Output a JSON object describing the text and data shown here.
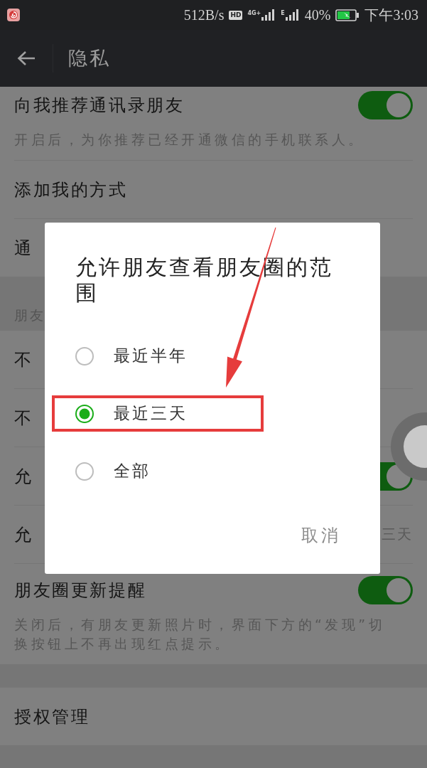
{
  "status_bar": {
    "network_speed": "512B/s",
    "hd_badge": "HD",
    "sim1_network": "4G+",
    "sim2_network": "E",
    "battery_percent": "40%",
    "time": "下午3:03"
  },
  "nav_bar": {
    "title": "隐私"
  },
  "sections": [
    {
      "rows": [
        {
          "kind": "switch",
          "title": "向我推荐通讯录朋友",
          "on": true,
          "description": "开启后，为你推荐已经开通微信的手机联系人。"
        },
        {
          "kind": "plain",
          "title": "添加我的方式"
        },
        {
          "kind": "plain",
          "title": "通"
        }
      ]
    },
    {
      "header": "朋友",
      "rows": [
        {
          "kind": "plain",
          "title": "不"
        },
        {
          "kind": "plain",
          "title": "不"
        },
        {
          "kind": "switch",
          "title": "允",
          "on": true
        },
        {
          "kind": "value",
          "title": "允",
          "value": "三天"
        },
        {
          "kind": "switch",
          "title": "朋友圈更新提醒",
          "on": true,
          "description": "关闭后，有朋友更新照片时，界面下方的“发现”切换按钮上不再出现红点提示。"
        }
      ]
    },
    {
      "rows": [
        {
          "kind": "plain",
          "title": "授权管理"
        }
      ]
    }
  ],
  "dialog": {
    "title": "允许朋友查看朋友圈的范围",
    "options": [
      {
        "label": "最近半年",
        "selected": false
      },
      {
        "label": "最近三天",
        "selected": true
      },
      {
        "label": "全部",
        "selected": false
      }
    ],
    "buttons": [
      "取消"
    ]
  }
}
